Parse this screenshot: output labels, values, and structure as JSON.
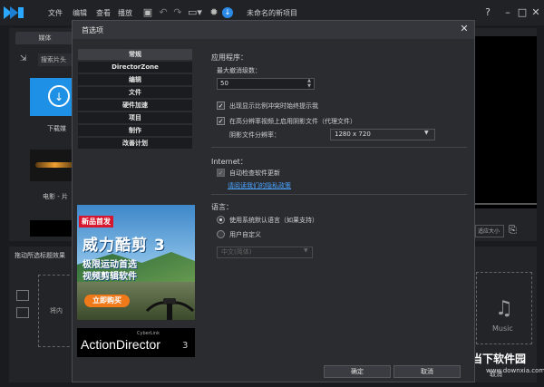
{
  "app": {
    "title": "未命名的新项目",
    "menu": [
      "文件",
      "编辑",
      "查看",
      "播放"
    ],
    "toolbar_icons": [
      "save-icon",
      "undo-icon",
      "redo-icon",
      "screen-icon",
      "gear-icon",
      "info-icon"
    ],
    "window_controls": [
      "?",
      "–",
      "□",
      "✕"
    ]
  },
  "background": {
    "media_tab": "媒体",
    "search_placeholder": "搜索片头",
    "download_label": "下载媒",
    "movie_label": "电影 - 片",
    "drop_hint": "拖动所选标题效果",
    "drop_area_text": "将内",
    "preview_select": "适应大小",
    "music_label": "Music",
    "cancel_text": "取消"
  },
  "watermark": {
    "logo": "U",
    "name": "当下软件园",
    "url": "www.downxia.com"
  },
  "dialog": {
    "title": "首选项",
    "close": "✕",
    "nav": [
      {
        "label": "常规",
        "active": true
      },
      {
        "label": "DirectorZone",
        "active": false
      },
      {
        "label": "编辑",
        "active": false
      },
      {
        "label": "文件",
        "active": false
      },
      {
        "label": "硬件加速",
        "active": false
      },
      {
        "label": "项目",
        "active": false
      },
      {
        "label": "制作",
        "active": false
      },
      {
        "label": "改善计划",
        "active": false
      }
    ],
    "ad": {
      "badge": "新品首发",
      "title": "威力酷剪 3",
      "line1": "极限运动首选",
      "line2": "视频剪辑软件",
      "buy": "立即购买"
    },
    "brand": {
      "small": "CyberLink",
      "name": "ActionDirector",
      "version": "3"
    },
    "application": {
      "section": "应用程序：",
      "undo_label": "最大撤消级数：",
      "undo_value": "50",
      "aspect_warn": "出现显示比例冲突时始终提示我",
      "aspect_warn_checked": true,
      "shadow_file": "在高分辨率视频上启用阴影文件（代理文件）",
      "shadow_file_checked": true,
      "shadow_res_label": "阴影文件分辨率：",
      "shadow_res_value": "1280 x 720"
    },
    "internet": {
      "section": "Internet：",
      "auto_update": "自动检查软件更新",
      "auto_update_checked": true,
      "privacy_link": "请阅读我们的隐私政策"
    },
    "language": {
      "section": "语言：",
      "system_default": "使用系统默认语言（如果支持）",
      "custom": "用户自定义",
      "custom_value": "中文(简体)"
    },
    "buttons": {
      "ok": "确定",
      "cancel": "取消"
    }
  }
}
